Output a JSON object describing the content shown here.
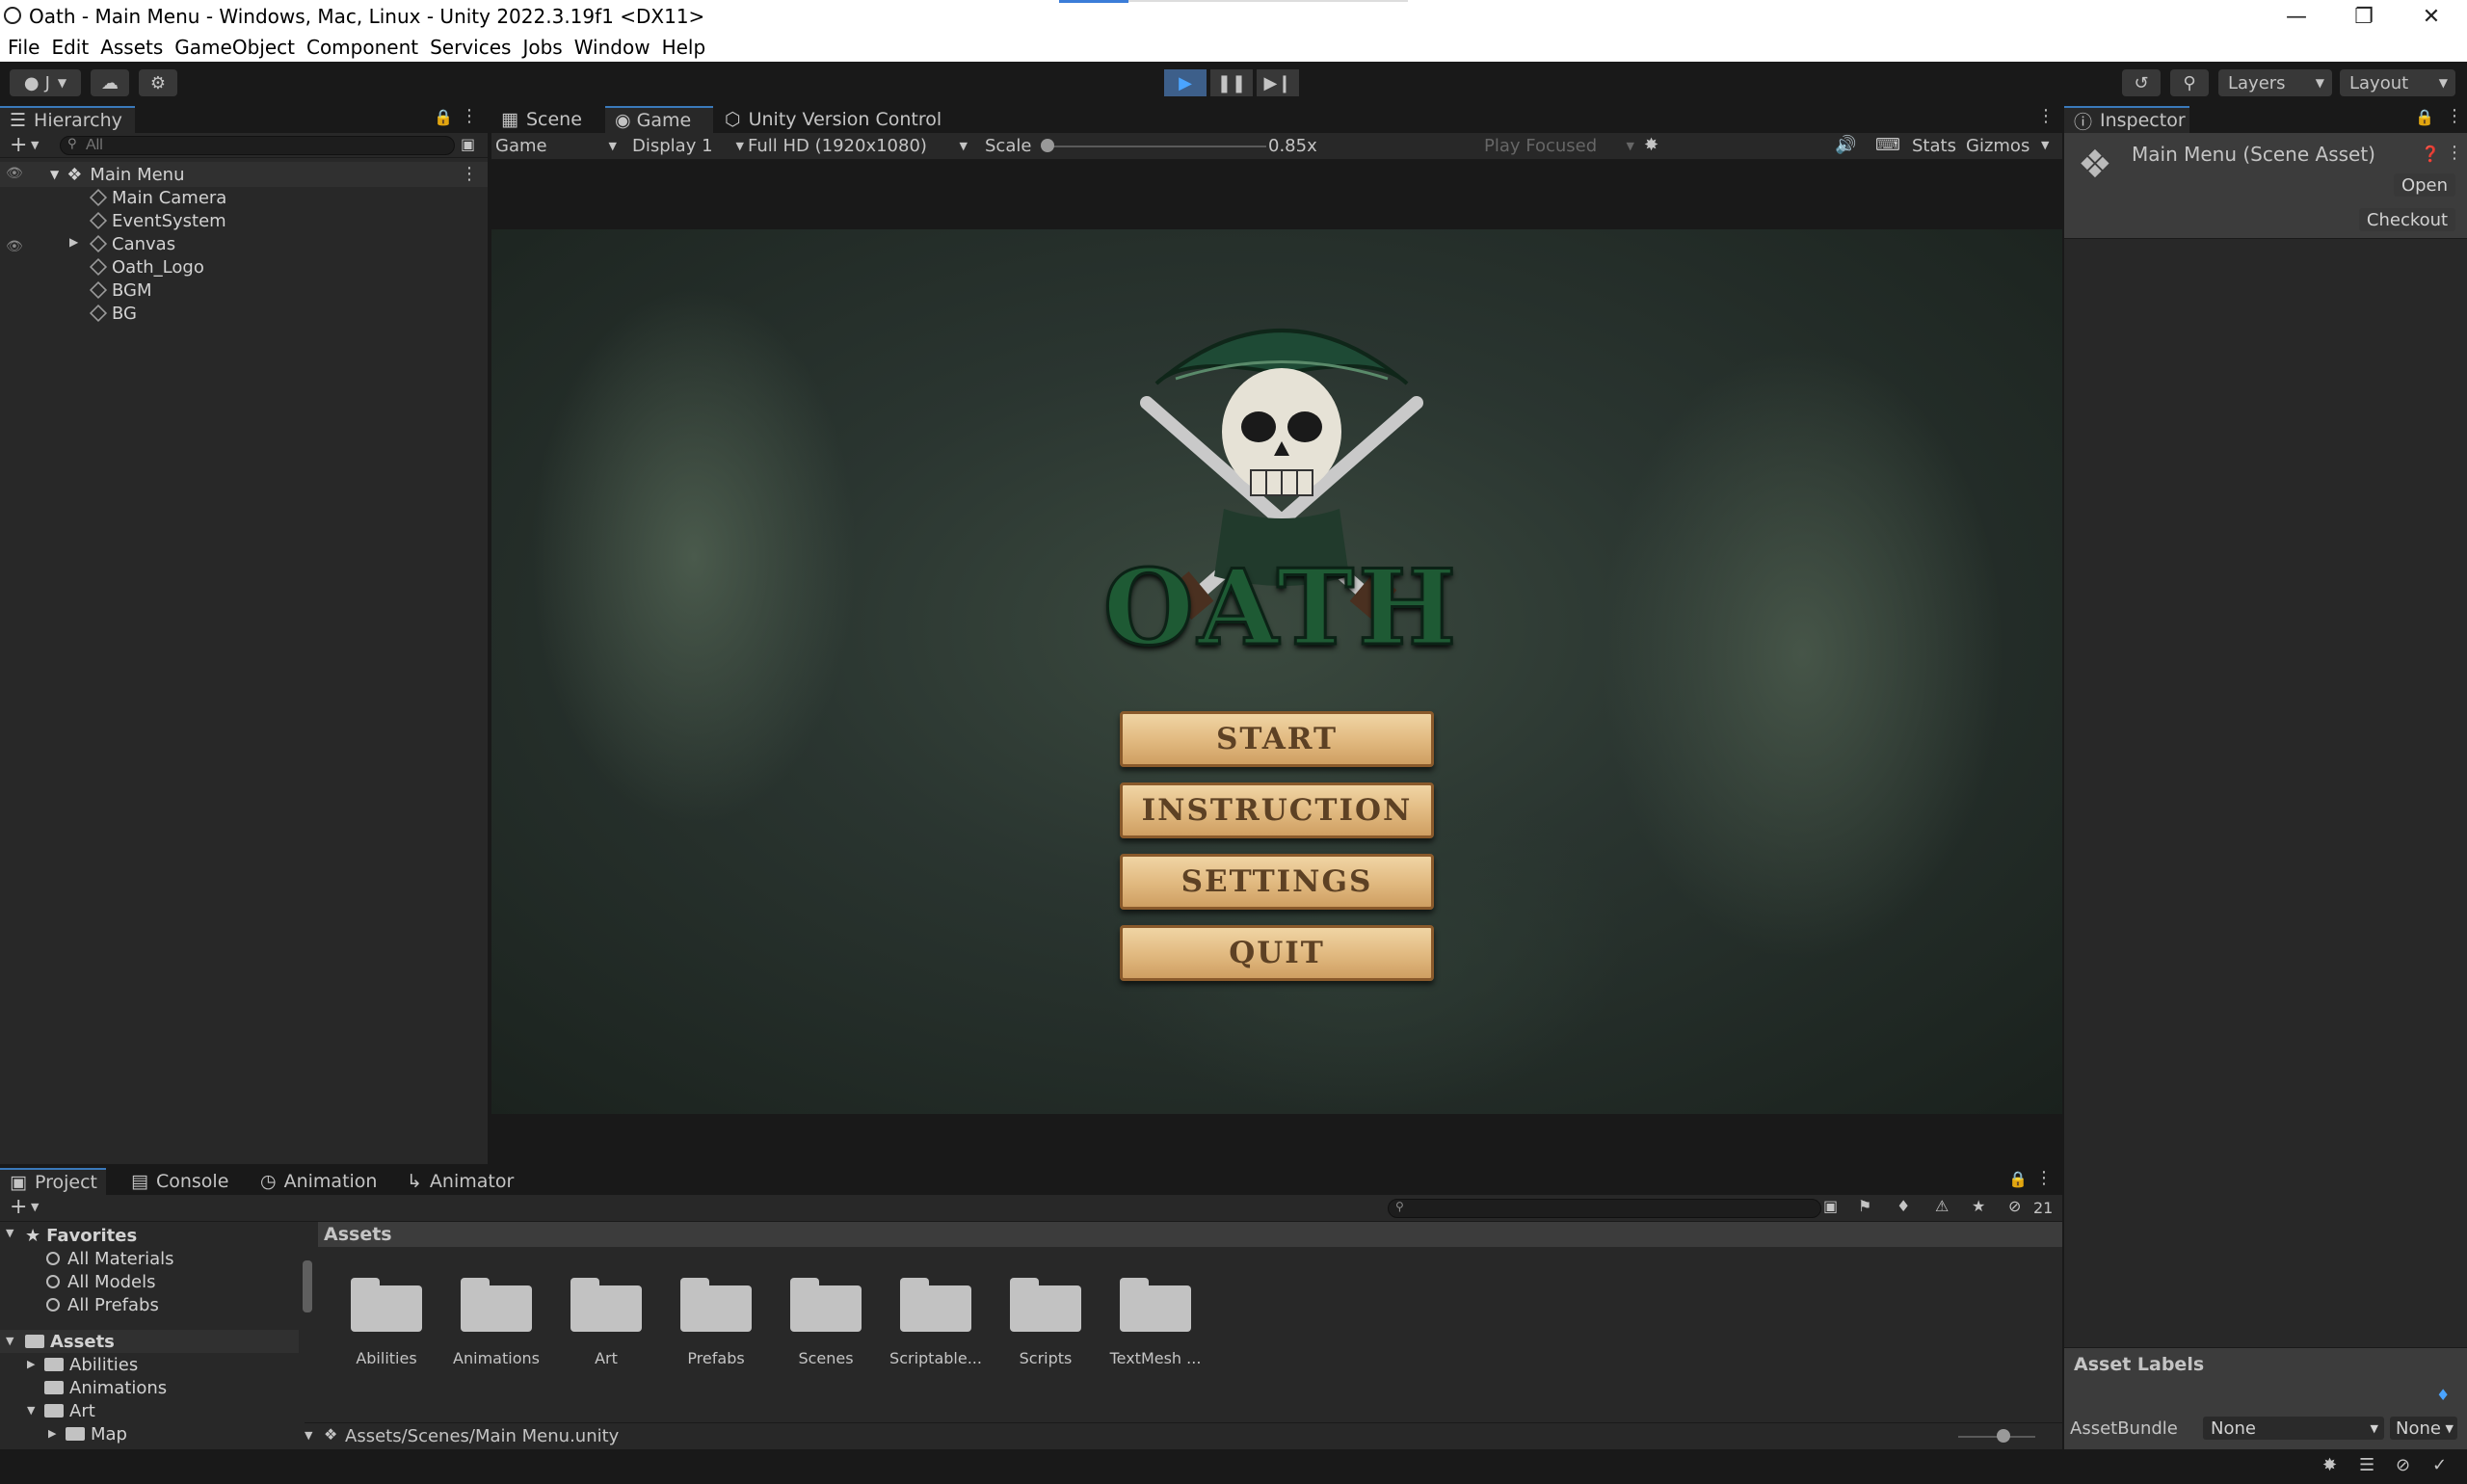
{
  "window": {
    "title": "Oath - Main Menu - Windows, Mac, Linux - Unity 2022.3.19f1 <DX11>",
    "minimize_icon": "minimize-icon",
    "maximize_icon": "restore-icon",
    "close_icon": "close-icon"
  },
  "menubar": [
    "File",
    "Edit",
    "Assets",
    "GameObject",
    "Component",
    "Services",
    "Jobs",
    "Window",
    "Help"
  ],
  "toolbar": {
    "account_label": "J",
    "layers_label": "Layers",
    "layout_label": "Layout"
  },
  "hierarchy": {
    "tab_label": "Hierarchy",
    "search_placeholder": "All",
    "scene_name": "Main Menu",
    "items": [
      "Main Camera",
      "EventSystem",
      "Canvas",
      "Oath_Logo",
      "BGM",
      "BG"
    ]
  },
  "center_tabs": [
    "Scene",
    "Game",
    "Unity Version Control"
  ],
  "game_bar": {
    "mode": "Game",
    "display": "Display 1",
    "resolution": "Full HD (1920x1080)",
    "scale_label": "Scale",
    "scale_value": "0.85x",
    "play_focused": "Play Focused",
    "stats": "Stats",
    "gizmos": "Gizmos"
  },
  "game_view": {
    "logo_text": "OATH",
    "buttons": [
      "START",
      "INSTRUCTION",
      "SETTINGS",
      "QUIT"
    ]
  },
  "inspector": {
    "tab_label": "Inspector",
    "asset_title": "Main Menu (Scene Asset)",
    "open_button": "Open",
    "checkout_button": "Checkout",
    "asset_labels": "Asset Labels",
    "assetbundle_label": "AssetBundle",
    "assetbundle_value": "None",
    "variant_value": "None"
  },
  "bottom_tabs": [
    "Project",
    "Console",
    "Animation",
    "Animator"
  ],
  "project": {
    "hidden_count": "21",
    "favorites_label": "Favorites",
    "favorites": [
      "All Materials",
      "All Models",
      "All Prefabs"
    ],
    "assets_label": "Assets",
    "tree": [
      "Abilities",
      "Animations",
      "Art",
      "Map"
    ],
    "breadcrumb": "Assets",
    "folders": [
      "Abilities",
      "Animations",
      "Art",
      "Prefabs",
      "Scenes",
      "Scriptable...",
      "Scripts",
      "TextMesh ..."
    ],
    "path": "Assets/Scenes/Main Menu.unity"
  },
  "colors": {
    "accent": "#3a79bb",
    "panel": "#282828",
    "background": "#191919",
    "button_text": "#5d4124",
    "logo_green": "#1e5a34"
  }
}
